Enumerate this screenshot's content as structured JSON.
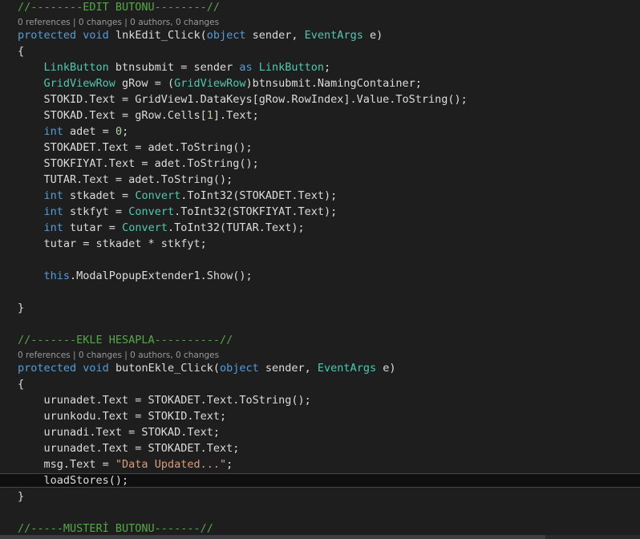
{
  "colors": {
    "background": "#1e1e1e",
    "text": "#dcdcdc",
    "comment": "#57a64a",
    "keyword": "#569cd6",
    "type": "#4ec9b0",
    "string": "#d69d85",
    "number": "#b5cea8",
    "codelens": "#999999"
  },
  "editor": {
    "lines": [
      {
        "kind": "code",
        "tokens": [
          [
            "comment",
            "//--------EDIT BUTONU--------//"
          ]
        ]
      },
      {
        "kind": "lens",
        "text": "0 references | 0 changes | 0 authors, 0 changes"
      },
      {
        "kind": "code",
        "tokens": [
          [
            "keyword",
            "protected"
          ],
          [
            "plain",
            " "
          ],
          [
            "keyword",
            "void"
          ],
          [
            "plain",
            " lnkEdit_Click("
          ],
          [
            "keyword",
            "object"
          ],
          [
            "plain",
            " sender, "
          ],
          [
            "type",
            "EventArgs"
          ],
          [
            "plain",
            " e)"
          ]
        ]
      },
      {
        "kind": "code",
        "tokens": [
          [
            "plain",
            "{"
          ]
        ]
      },
      {
        "kind": "code",
        "tokens": [
          [
            "plain",
            "    "
          ],
          [
            "type",
            "LinkButton"
          ],
          [
            "plain",
            " btnsubmit = sender "
          ],
          [
            "keyword",
            "as"
          ],
          [
            "plain",
            " "
          ],
          [
            "type",
            "LinkButton"
          ],
          [
            "plain",
            ";"
          ]
        ]
      },
      {
        "kind": "code",
        "tokens": [
          [
            "plain",
            "    "
          ],
          [
            "type",
            "GridViewRow"
          ],
          [
            "plain",
            " gRow = ("
          ],
          [
            "type",
            "GridViewRow"
          ],
          [
            "plain",
            ")btnsubmit.NamingContainer;"
          ]
        ]
      },
      {
        "kind": "code",
        "tokens": [
          [
            "plain",
            "    STOKID.Text = GridView1.DataKeys[gRow.RowIndex].Value.ToString();"
          ]
        ]
      },
      {
        "kind": "code",
        "tokens": [
          [
            "plain",
            "    STOKAD.Text = gRow.Cells["
          ],
          [
            "number",
            "1"
          ],
          [
            "plain",
            "].Text;"
          ]
        ]
      },
      {
        "kind": "code",
        "tokens": [
          [
            "plain",
            "    "
          ],
          [
            "keyword",
            "int"
          ],
          [
            "plain",
            " adet = "
          ],
          [
            "number",
            "0"
          ],
          [
            "plain",
            ";"
          ]
        ]
      },
      {
        "kind": "code",
        "tokens": [
          [
            "plain",
            "    STOKADET.Text = adet.ToString();"
          ]
        ]
      },
      {
        "kind": "code",
        "tokens": [
          [
            "plain",
            "    STOKFIYAT.Text = adet.ToString();"
          ]
        ]
      },
      {
        "kind": "code",
        "tokens": [
          [
            "plain",
            "    TUTAR.Text = adet.ToString();"
          ]
        ]
      },
      {
        "kind": "code",
        "tokens": [
          [
            "plain",
            "    "
          ],
          [
            "keyword",
            "int"
          ],
          [
            "plain",
            " stkadet = "
          ],
          [
            "type",
            "Convert"
          ],
          [
            "plain",
            ".ToInt32(STOKADET.Text);"
          ]
        ]
      },
      {
        "kind": "code",
        "tokens": [
          [
            "plain",
            "    "
          ],
          [
            "keyword",
            "int"
          ],
          [
            "plain",
            " stkfyt = "
          ],
          [
            "type",
            "Convert"
          ],
          [
            "plain",
            ".ToInt32(STOKFIYAT.Text);"
          ]
        ]
      },
      {
        "kind": "code",
        "tokens": [
          [
            "plain",
            "    "
          ],
          [
            "keyword",
            "int"
          ],
          [
            "plain",
            " tutar = "
          ],
          [
            "type",
            "Convert"
          ],
          [
            "plain",
            ".ToInt32(TUTAR.Text);"
          ]
        ]
      },
      {
        "kind": "code",
        "tokens": [
          [
            "plain",
            "    tutar = stkadet * stkfyt;"
          ]
        ]
      },
      {
        "kind": "code",
        "tokens": [
          [
            "plain",
            ""
          ]
        ]
      },
      {
        "kind": "code",
        "tokens": [
          [
            "plain",
            "    "
          ],
          [
            "keyword",
            "this"
          ],
          [
            "plain",
            ".ModalPopupExtender1.Show();"
          ]
        ]
      },
      {
        "kind": "code",
        "tokens": [
          [
            "plain",
            ""
          ]
        ]
      },
      {
        "kind": "code",
        "tokens": [
          [
            "plain",
            "}"
          ]
        ]
      },
      {
        "kind": "code",
        "tokens": [
          [
            "plain",
            ""
          ]
        ]
      },
      {
        "kind": "code",
        "tokens": [
          [
            "comment",
            "//-------EKLE HESAPLA----------//"
          ]
        ]
      },
      {
        "kind": "lens",
        "text": "0 references | 0 changes | 0 authors, 0 changes"
      },
      {
        "kind": "code",
        "tokens": [
          [
            "keyword",
            "protected"
          ],
          [
            "plain",
            " "
          ],
          [
            "keyword",
            "void"
          ],
          [
            "plain",
            " butonEkle_Click("
          ],
          [
            "keyword",
            "object"
          ],
          [
            "plain",
            " sender, "
          ],
          [
            "type",
            "EventArgs"
          ],
          [
            "plain",
            " e)"
          ]
        ]
      },
      {
        "kind": "code",
        "tokens": [
          [
            "plain",
            "{"
          ]
        ]
      },
      {
        "kind": "code",
        "tokens": [
          [
            "plain",
            "    urunadet.Text = STOKADET.Text.ToString();"
          ]
        ]
      },
      {
        "kind": "code",
        "tokens": [
          [
            "plain",
            "    urunkodu.Text = STOKID.Text;"
          ]
        ]
      },
      {
        "kind": "code",
        "tokens": [
          [
            "plain",
            "    urunadi.Text = STOKAD.Text;"
          ]
        ]
      },
      {
        "kind": "code",
        "tokens": [
          [
            "plain",
            "    urunadet.Text = STOKADET.Text;"
          ]
        ]
      },
      {
        "kind": "code",
        "tokens": [
          [
            "plain",
            "    msg.Text = "
          ],
          [
            "string",
            "\"Data Updated...\""
          ],
          [
            "plain",
            ";"
          ]
        ]
      },
      {
        "kind": "code",
        "current": true,
        "tokens": [
          [
            "plain",
            "    loadStores();"
          ]
        ]
      },
      {
        "kind": "code",
        "tokens": [
          [
            "plain",
            "}"
          ]
        ]
      },
      {
        "kind": "code",
        "tokens": [
          [
            "plain",
            ""
          ]
        ]
      },
      {
        "kind": "code",
        "tokens": [
          [
            "comment",
            "//-----MUSTERİ BUTONU-------//"
          ]
        ]
      }
    ]
  }
}
